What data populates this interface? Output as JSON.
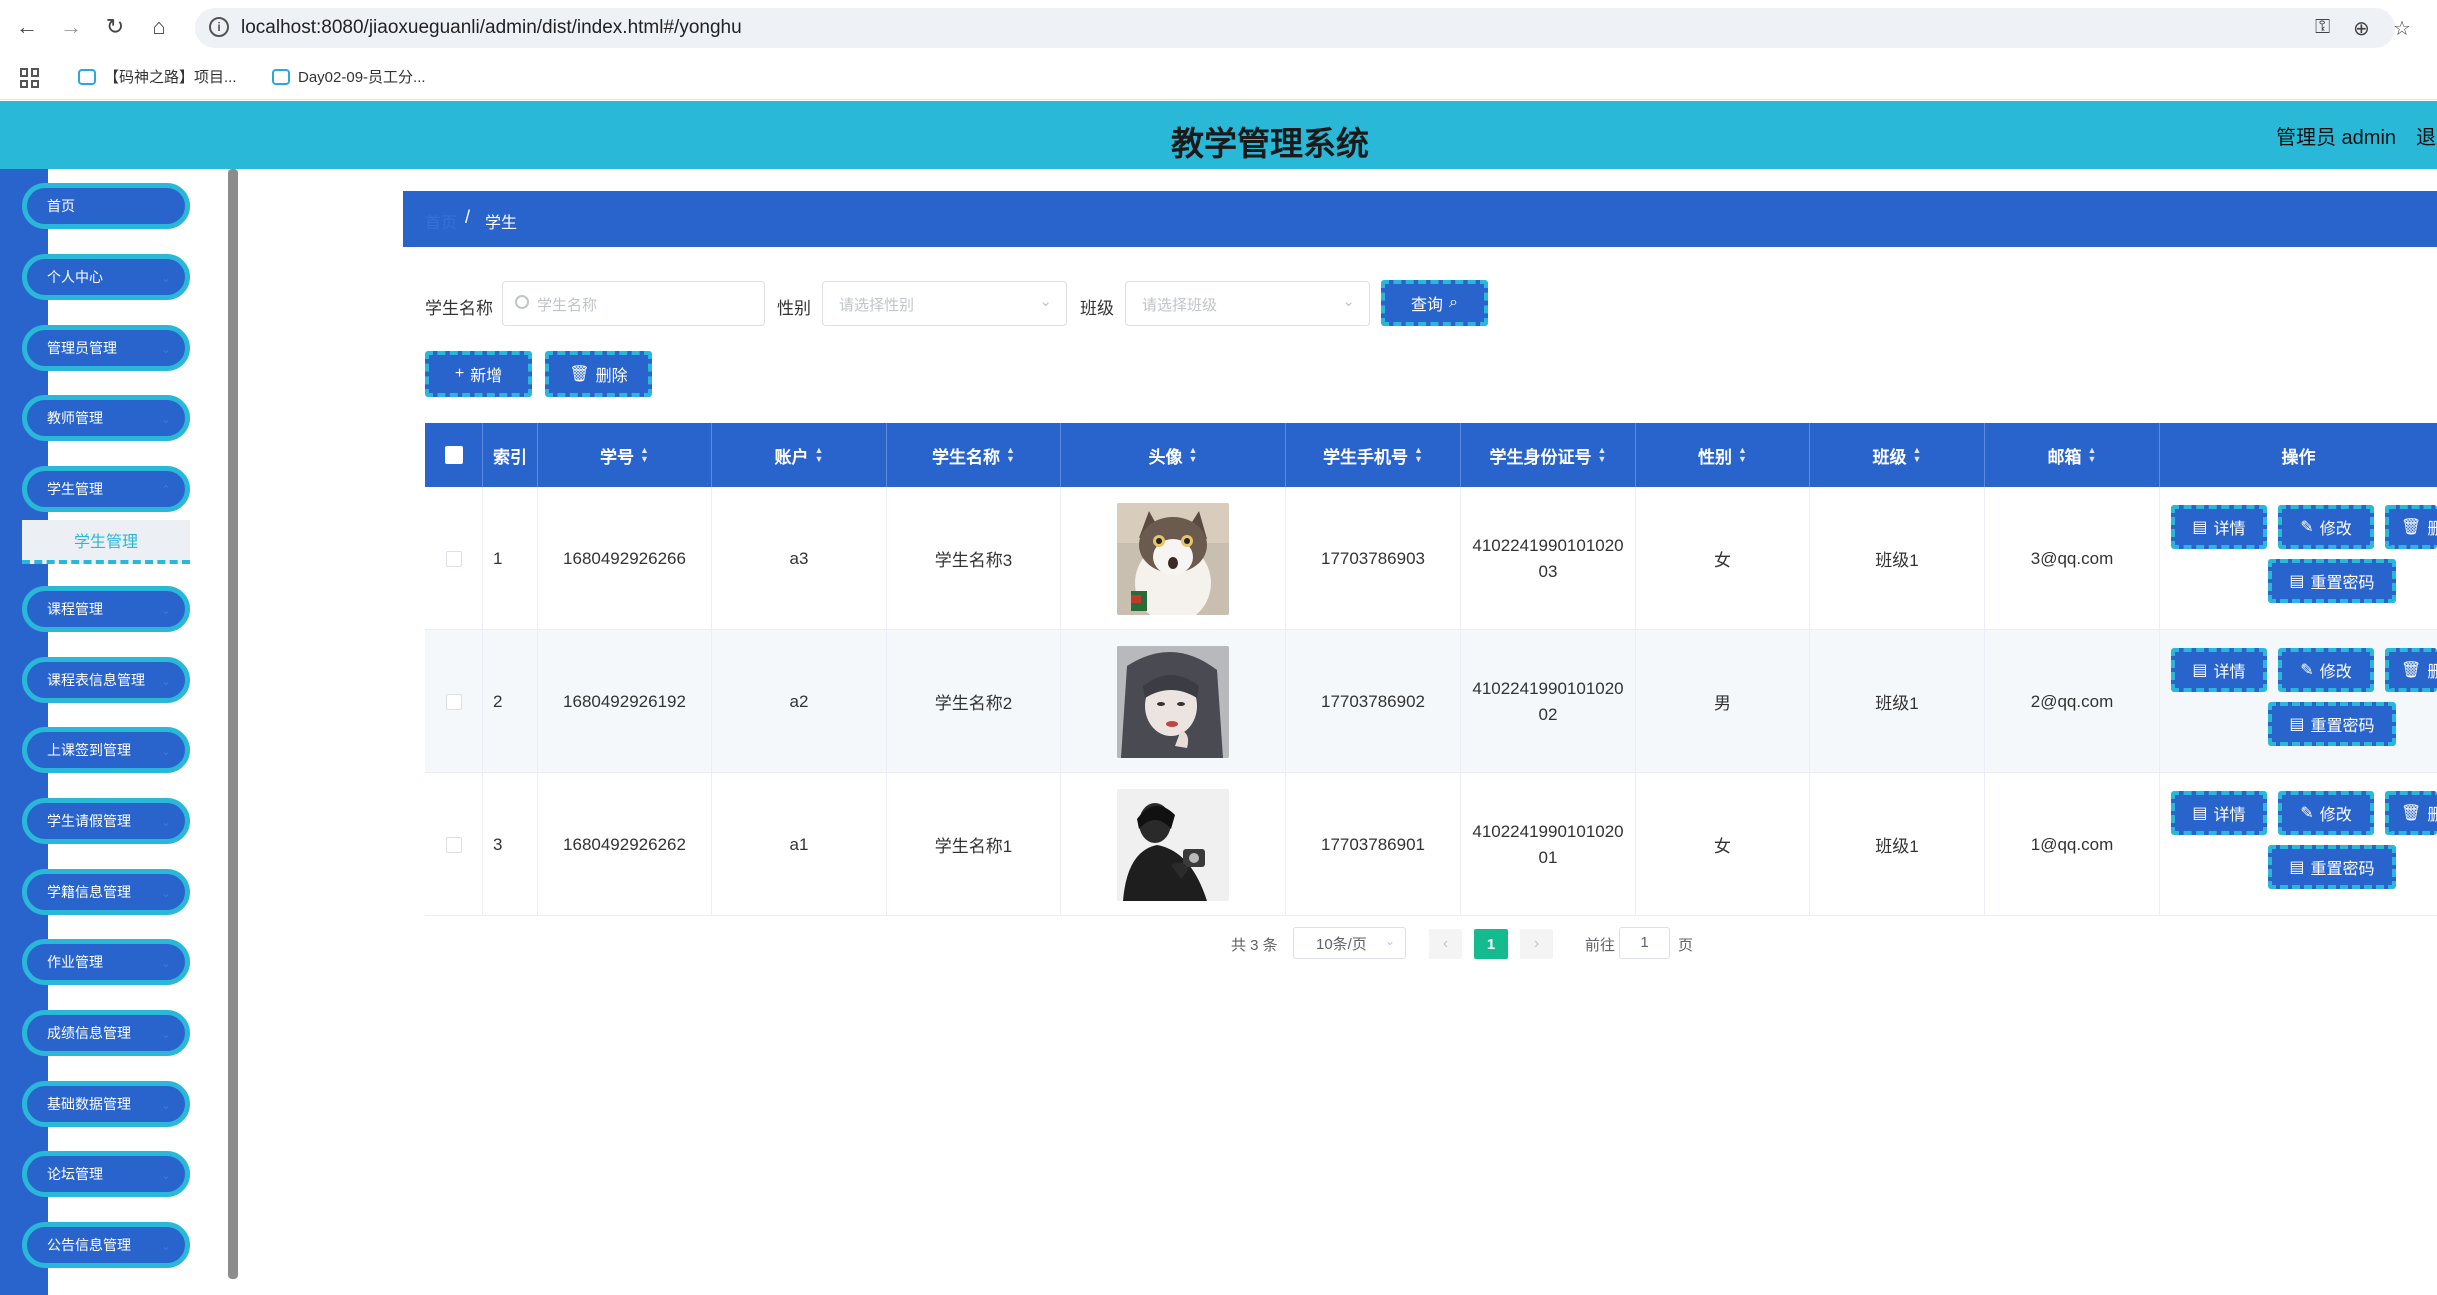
{
  "browser": {
    "url": "localhost:8080/jiaoxueguanli/admin/dist/index.html#/yonghu",
    "bookmarks": [
      "【码神之路】项目...",
      "Day02-09-员工分..."
    ]
  },
  "header": {
    "title": "教学管理系统",
    "admin": "管理员 admin",
    "logout": "退"
  },
  "sidebar": {
    "items": [
      {
        "label": "首页"
      },
      {
        "label": "个人中心"
      },
      {
        "label": "管理员管理"
      },
      {
        "label": "教师管理"
      },
      {
        "label": "学生管理"
      },
      {
        "label": "课程管理"
      },
      {
        "label": "课程表信息管理"
      },
      {
        "label": "上课签到管理"
      },
      {
        "label": "学生请假管理"
      },
      {
        "label": "学籍信息管理"
      },
      {
        "label": "作业管理"
      },
      {
        "label": "成绩信息管理"
      },
      {
        "label": "基础数据管理"
      },
      {
        "label": "论坛管理"
      },
      {
        "label": "公告信息管理"
      }
    ],
    "active_sub": "学生管理"
  },
  "breadcrumb": {
    "home": "首页",
    "separator": "/",
    "current": "学生"
  },
  "search": {
    "name_label": "学生名称",
    "name_placeholder": "学生名称",
    "gender_label": "性别",
    "gender_placeholder": "请选择性别",
    "class_label": "班级",
    "class_placeholder": "请选择班级",
    "query_button": "查询"
  },
  "actions": {
    "add": "新增",
    "delete": "删除"
  },
  "table": {
    "headers": {
      "index": "索引",
      "student_no": "学号",
      "account": "账户",
      "name": "学生名称",
      "avatar": "头像",
      "phone": "学生手机号",
      "id_card": "学生身份证号",
      "gender": "性别",
      "class": "班级",
      "email": "邮箱",
      "ops": "操作"
    },
    "rows": [
      {
        "index": "1",
        "student_no": "1680492926266",
        "account": "a3",
        "name": "学生名称3",
        "phone": "17703786903",
        "id_card_1": "4102241990101020",
        "id_card_2": "03",
        "gender": "女",
        "class": "班级1",
        "email": "3@qq.com"
      },
      {
        "index": "2",
        "student_no": "1680492926192",
        "account": "a2",
        "name": "学生名称2",
        "phone": "17703786902",
        "id_card_1": "4102241990101020",
        "id_card_2": "02",
        "gender": "男",
        "class": "班级1",
        "email": "2@qq.com"
      },
      {
        "index": "3",
        "student_no": "1680492926262",
        "account": "a1",
        "name": "学生名称1",
        "phone": "17703786901",
        "id_card_1": "4102241990101020",
        "id_card_2": "01",
        "gender": "女",
        "class": "班级1",
        "email": "1@qq.com"
      }
    ],
    "op_labels": {
      "detail": "详情",
      "edit": "修改",
      "delete": "删",
      "reset": "重置密码"
    }
  },
  "pagination": {
    "total": "共 3 条",
    "page_size": "10条/页",
    "current_page": "1",
    "goto_label": "前往",
    "goto_value": "1",
    "page_suffix": "页"
  },
  "colors": {
    "primary": "#2964cc",
    "accent": "#29b8d8",
    "pager_active": "#13bb8f"
  }
}
